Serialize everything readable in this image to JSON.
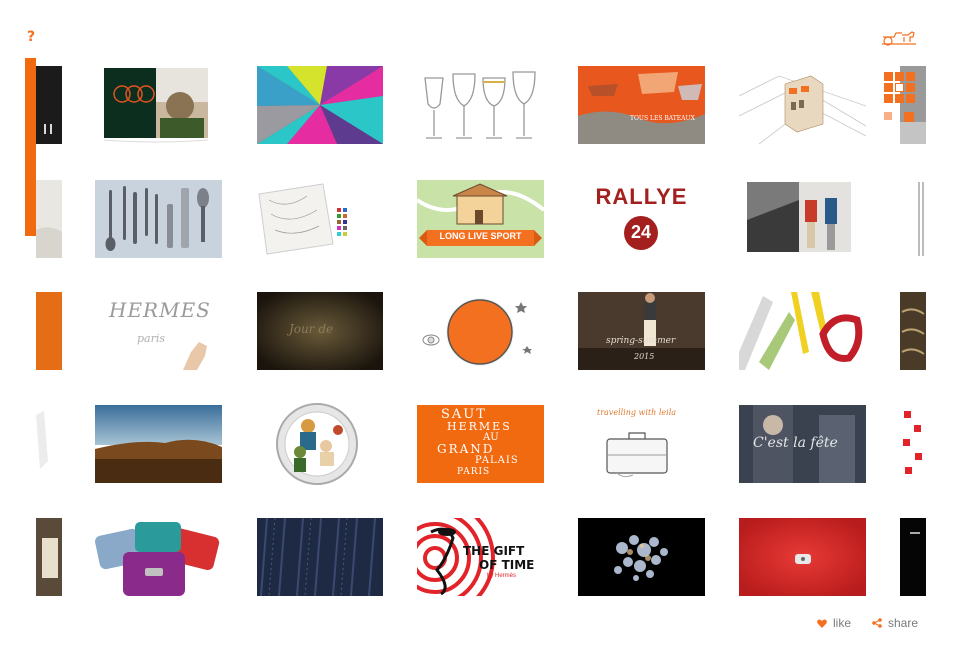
{
  "header": {
    "help_label": "?"
  },
  "brand": {
    "accent_color": "#f37021",
    "logo_icon": "caleche-logo-icon"
  },
  "footer": {
    "like_label": "like",
    "share_label": "share"
  },
  "tiles": {
    "r2c4": {
      "line1": "LONG LIVE SPORT"
    },
    "r2c5": {
      "line1": "RALLYE",
      "line2": "24"
    },
    "r3c2": {
      "line1": "HERMES",
      "line2": "paris"
    },
    "r3c3": {
      "line1": "Jour de"
    },
    "r3c5": {
      "line1": "spring-summer",
      "line2": "2015"
    },
    "r4c4": {
      "line1": "SAUT",
      "line2": "HERMES",
      "line3": "AU",
      "line4": "GRAND",
      "line5": "PALAIS",
      "line6": "PARIS"
    },
    "r4c5": {
      "line1": "travelling with leila"
    },
    "r4c6": {
      "line1": "C'est la fête"
    },
    "r5c4": {
      "line1": "THE GIFT",
      "line2": "OF TIME",
      "line3": "by Hermès"
    }
  }
}
